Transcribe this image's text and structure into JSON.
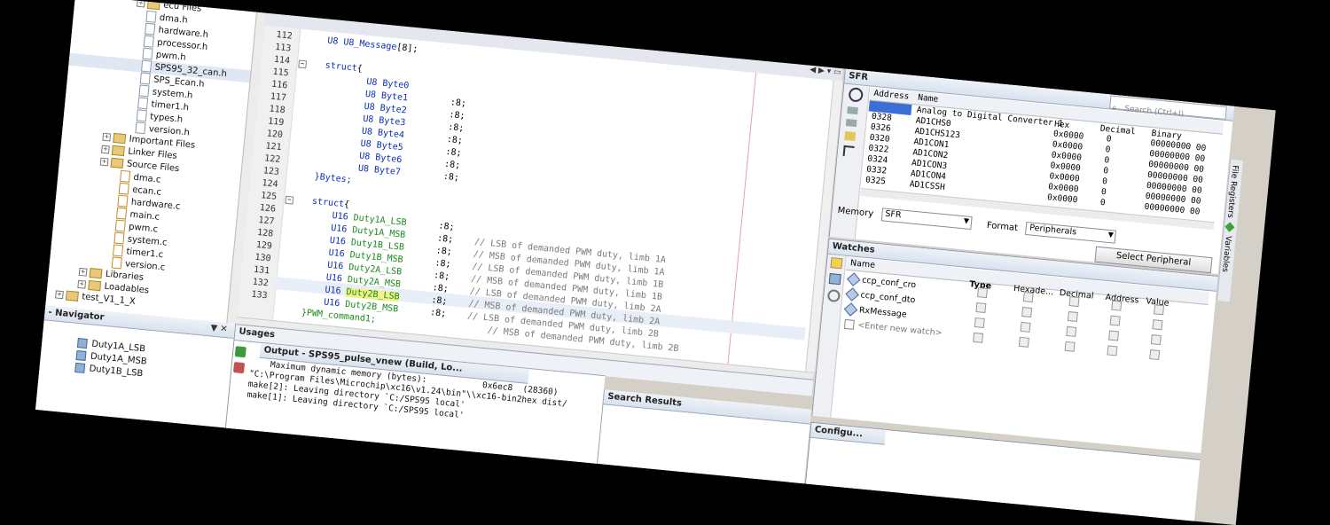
{
  "project_tree": {
    "items": [
      {
        "label": "ecu Files",
        "kind": "folder",
        "indent": 5
      },
      {
        "label": "dma.h",
        "kind": "h",
        "indent": 6
      },
      {
        "label": "hardware.h",
        "kind": "h",
        "indent": 6
      },
      {
        "label": "processor.h",
        "kind": "h",
        "indent": 6
      },
      {
        "label": "pwm.h",
        "kind": "h",
        "indent": 6
      },
      {
        "label": "SPS95_32_can.h",
        "kind": "h",
        "indent": 6
      },
      {
        "label": "SPS_Ecan.h",
        "kind": "h",
        "indent": 6
      },
      {
        "label": "system.h",
        "kind": "h",
        "indent": 6
      },
      {
        "label": "timer1.h",
        "kind": "h",
        "indent": 6
      },
      {
        "label": "types.h",
        "kind": "h",
        "indent": 6
      },
      {
        "label": "version.h",
        "kind": "h",
        "indent": 6
      },
      {
        "label": "Important Files",
        "kind": "folder",
        "indent": 3
      },
      {
        "label": "Linker Files",
        "kind": "folder",
        "indent": 3
      },
      {
        "label": "Source Files",
        "kind": "folder",
        "indent": 3
      },
      {
        "label": "dma.c",
        "kind": "c",
        "indent": 5
      },
      {
        "label": "ecan.c",
        "kind": "c",
        "indent": 5
      },
      {
        "label": "hardware.c",
        "kind": "c",
        "indent": 5
      },
      {
        "label": "main.c",
        "kind": "c",
        "indent": 5
      },
      {
        "label": "pwm.c",
        "kind": "c",
        "indent": 5
      },
      {
        "label": "system.c",
        "kind": "c",
        "indent": 5
      },
      {
        "label": "timer1.c",
        "kind": "c",
        "indent": 5
      },
      {
        "label": "version.c",
        "kind": "c",
        "indent": 5
      },
      {
        "label": "Libraries",
        "kind": "folder",
        "indent": 2
      },
      {
        "label": "Loadables",
        "kind": "folder",
        "indent": 2
      },
      {
        "label": "test_V1_1_X",
        "kind": "project",
        "indent": 0
      }
    ]
  },
  "navigator": {
    "title": "- Navigator",
    "items": [
      "Duty1A_LSB",
      "Duty1A_MSB",
      "Duty1B_LSB"
    ]
  },
  "editor": {
    "lines": [
      {
        "n": "112",
        "parts": [
          [
            "    ",
            ""
          ],
          [
            "U8 U8_Message",
            "kw"
          ],
          [
            "[8];",
            ""
          ]
        ]
      },
      {
        "n": "113",
        "parts": [
          [
            "",
            ""
          ]
        ]
      },
      {
        "n": "114",
        "parts": [
          [
            "    ",
            ""
          ],
          [
            "struct",
            "kw"
          ],
          [
            "{",
            ""
          ]
        ]
      },
      {
        "n": "115",
        "parts": [
          [
            "            ",
            ""
          ],
          [
            "U8 Byte0",
            "kw"
          ]
        ]
      },
      {
        "n": "116",
        "parts": [
          [
            "            ",
            ""
          ],
          [
            "U8 Byte1",
            "kw"
          ],
          [
            "        :8;",
            ""
          ]
        ]
      },
      {
        "n": "117",
        "parts": [
          [
            "            ",
            ""
          ],
          [
            "U8 Byte2",
            "kw"
          ],
          [
            "        :8;",
            ""
          ]
        ]
      },
      {
        "n": "118",
        "parts": [
          [
            "            ",
            ""
          ],
          [
            "U8 Byte3",
            "kw"
          ],
          [
            "        :8;",
            ""
          ]
        ]
      },
      {
        "n": "119",
        "parts": [
          [
            "            ",
            ""
          ],
          [
            "U8 Byte4",
            "kw"
          ],
          [
            "        :8;",
            ""
          ]
        ]
      },
      {
        "n": "120",
        "parts": [
          [
            "            ",
            ""
          ],
          [
            "U8 Byte5",
            "kw"
          ],
          [
            "        :8;",
            ""
          ]
        ]
      },
      {
        "n": "121",
        "parts": [
          [
            "            ",
            ""
          ],
          [
            "U8 Byte6",
            "kw"
          ],
          [
            "        :8;",
            ""
          ]
        ]
      },
      {
        "n": "122",
        "parts": [
          [
            "            ",
            ""
          ],
          [
            "U8 Byte7",
            "kw"
          ],
          [
            "        :8;",
            ""
          ]
        ]
      },
      {
        "n": "123",
        "parts": [
          [
            "    ",
            ""
          ],
          [
            "}Bytes;",
            "kw"
          ]
        ]
      },
      {
        "n": "124",
        "parts": [
          [
            "",
            ""
          ]
        ]
      },
      {
        "n": "125",
        "parts": [
          [
            "    ",
            ""
          ],
          [
            "struct",
            "kw"
          ],
          [
            "{",
            ""
          ]
        ]
      },
      {
        "n": "126",
        "parts": [
          [
            "        ",
            ""
          ],
          [
            "U16 ",
            "kw"
          ],
          [
            "Duty1A_LSB",
            "fld"
          ],
          [
            "      :8;",
            ""
          ]
        ]
      },
      {
        "n": "127",
        "parts": [
          [
            "        ",
            ""
          ],
          [
            "U16 ",
            "kw"
          ],
          [
            "Duty1A_MSB",
            "fld"
          ],
          [
            "      :8;    ",
            ""
          ],
          [
            "// LSB of demanded PWM duty, limb 1A",
            "cm"
          ]
        ]
      },
      {
        "n": "128",
        "parts": [
          [
            "        ",
            ""
          ],
          [
            "U16 ",
            "kw"
          ],
          [
            "Duty1B_LSB",
            "fld"
          ],
          [
            "      :8;    ",
            ""
          ],
          [
            "// MSB of demanded PWM duty, limb 1A",
            "cm"
          ]
        ]
      },
      {
        "n": "129",
        "parts": [
          [
            "        ",
            ""
          ],
          [
            "U16 ",
            "kw"
          ],
          [
            "Duty1B_MSB",
            "fld"
          ],
          [
            "      :8;    ",
            ""
          ],
          [
            "// LSB of demanded PWM duty, limb 1B",
            "cm"
          ]
        ]
      },
      {
        "n": "130",
        "parts": [
          [
            "        ",
            ""
          ],
          [
            "U16 ",
            "kw"
          ],
          [
            "Duty2A_LSB",
            "fld"
          ],
          [
            "      :8;    ",
            ""
          ],
          [
            "// MSB of demanded PWM duty, limb 1B",
            "cm"
          ]
        ]
      },
      {
        "n": "131",
        "parts": [
          [
            "        ",
            ""
          ],
          [
            "U16 ",
            "kw"
          ],
          [
            "Duty2A_MSB",
            "fld"
          ],
          [
            "      :8;    ",
            ""
          ],
          [
            "// LSB of demanded PWM duty, limb 2A",
            "cm"
          ]
        ]
      },
      {
        "n": "132",
        "parts": [
          [
            "        ",
            ""
          ],
          [
            "U16 ",
            "kw"
          ],
          [
            "Duty2B_LSB",
            "fld"
          ],
          [
            "      :8;    ",
            ""
          ],
          [
            "// MSB of demanded PWM duty, limb 2A",
            "cm"
          ]
        ]
      },
      {
        "n": "133",
        "parts": [
          [
            "        ",
            ""
          ],
          [
            "U16 ",
            "kw"
          ],
          [
            "Duty2B_MSB",
            "fld"
          ],
          [
            "      :8;    ",
            ""
          ],
          [
            "// LSB of demanded PWM duty, limb 2B",
            "cm"
          ]
        ]
      },
      {
        "n": "",
        "parts": [
          [
            "    ",
            ""
          ],
          [
            "}PWM_command1;",
            "fld"
          ],
          [
            "                     ",
            ""
          ],
          [
            "// MSB of demanded PWM duty, limb 2B",
            "cm"
          ]
        ]
      }
    ]
  },
  "sfr": {
    "title": "SFR",
    "search_placeholder": "Search (Ctrl+I)",
    "columns": [
      "Address",
      "Name",
      "Hex",
      "Decimal",
      "Binary"
    ],
    "group_label": "Analog to Digital Converter 1",
    "rows": [
      {
        "addr": "0328",
        "name": "AD1CHS0",
        "hex": "0x0000",
        "dec": "0",
        "bin": "00000000 00"
      },
      {
        "addr": "0326",
        "name": "AD1CHS123",
        "hex": "0x0000",
        "dec": "0",
        "bin": "00000000 00"
      },
      {
        "addr": "0320",
        "name": "AD1CON1",
        "hex": "0x0000",
        "dec": "0",
        "bin": "00000000 00"
      },
      {
        "addr": "0322",
        "name": "AD1CON2",
        "hex": "0x0000",
        "dec": "0",
        "bin": "00000000 00"
      },
      {
        "addr": "0324",
        "name": "AD1CON3",
        "hex": "0x0000",
        "dec": "0",
        "bin": "00000000 00"
      },
      {
        "addr": "0332",
        "name": "AD1CON4",
        "hex": "0x0000",
        "dec": "0",
        "bin": "00000000 00"
      },
      {
        "addr": "0325",
        "name": "AD1CSSH",
        "hex": "0x0000",
        "dec": "0",
        "bin": "00000000 00"
      }
    ],
    "memory_label": "Memory",
    "memory_value": "SFR",
    "format_label": "Format",
    "format_value": "Peripherals",
    "select_button": "Select Peripheral"
  },
  "side_tabs": {
    "file_registers": "File Registers",
    "variables": "Variables"
  },
  "watches": {
    "title": "Watches",
    "columns": [
      "Name",
      "Type",
      "Hexade...",
      "Decimal",
      "Address",
      "Value"
    ],
    "rows": [
      "ccp_conf_cro",
      "ccp_conf_dto",
      "RxMessage",
      "<Enter new watch>"
    ]
  },
  "usages": {
    "title": "Usages"
  },
  "output": {
    "tab": "Output - SPS95_pulse_vnew (Build, Lo...",
    "lines": [
      "    Maximum dynamic memory (bytes):           0x6ec8  (28360)",
      "\"C:\\Program Files\\Microchip\\xc16\\v1.24\\bin\"\\\\xc16-bin2hex dist/",
      "make[2]: Leaving directory `C:/SPS95 local'",
      "make[1]: Leaving directory `C:/SPS95 local'"
    ]
  },
  "search_results": {
    "title": "Search Results"
  },
  "config_tab": {
    "title": "Configu..."
  }
}
